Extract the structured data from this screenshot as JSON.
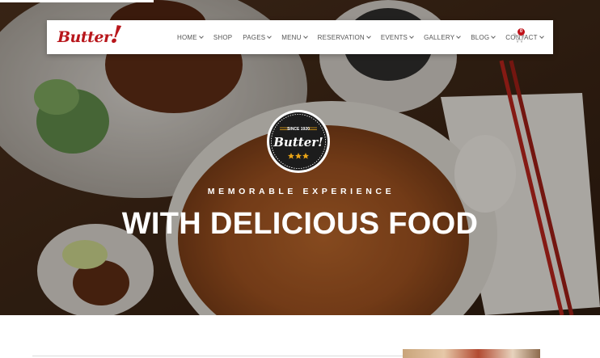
{
  "brand": {
    "name": "Butter",
    "mark": "!"
  },
  "nav": {
    "items": [
      {
        "label": "HOME",
        "has_dropdown": true
      },
      {
        "label": "SHOP",
        "has_dropdown": false
      },
      {
        "label": "PAGES",
        "has_dropdown": true
      },
      {
        "label": "MENU",
        "has_dropdown": true
      },
      {
        "label": "RESERVATION",
        "has_dropdown": true
      },
      {
        "label": "EVENTS",
        "has_dropdown": true
      },
      {
        "label": "GALLERY",
        "has_dropdown": true
      },
      {
        "label": "BLOG",
        "has_dropdown": true
      },
      {
        "label": "CONTACT",
        "has_dropdown": true
      }
    ],
    "cart_count": "0"
  },
  "hero": {
    "badge_since": "SINCE 1920",
    "badge_name": "Butter!",
    "badge_stars": 3,
    "tagline": "MEMORABLE EXPERIENCE",
    "headline": "WITH DELICIOUS FOOD"
  },
  "colors": {
    "brand_red": "#b8161b",
    "badge_star": "#e8a317",
    "nav_text": "#555555",
    "hero_text": "#ffffff"
  }
}
